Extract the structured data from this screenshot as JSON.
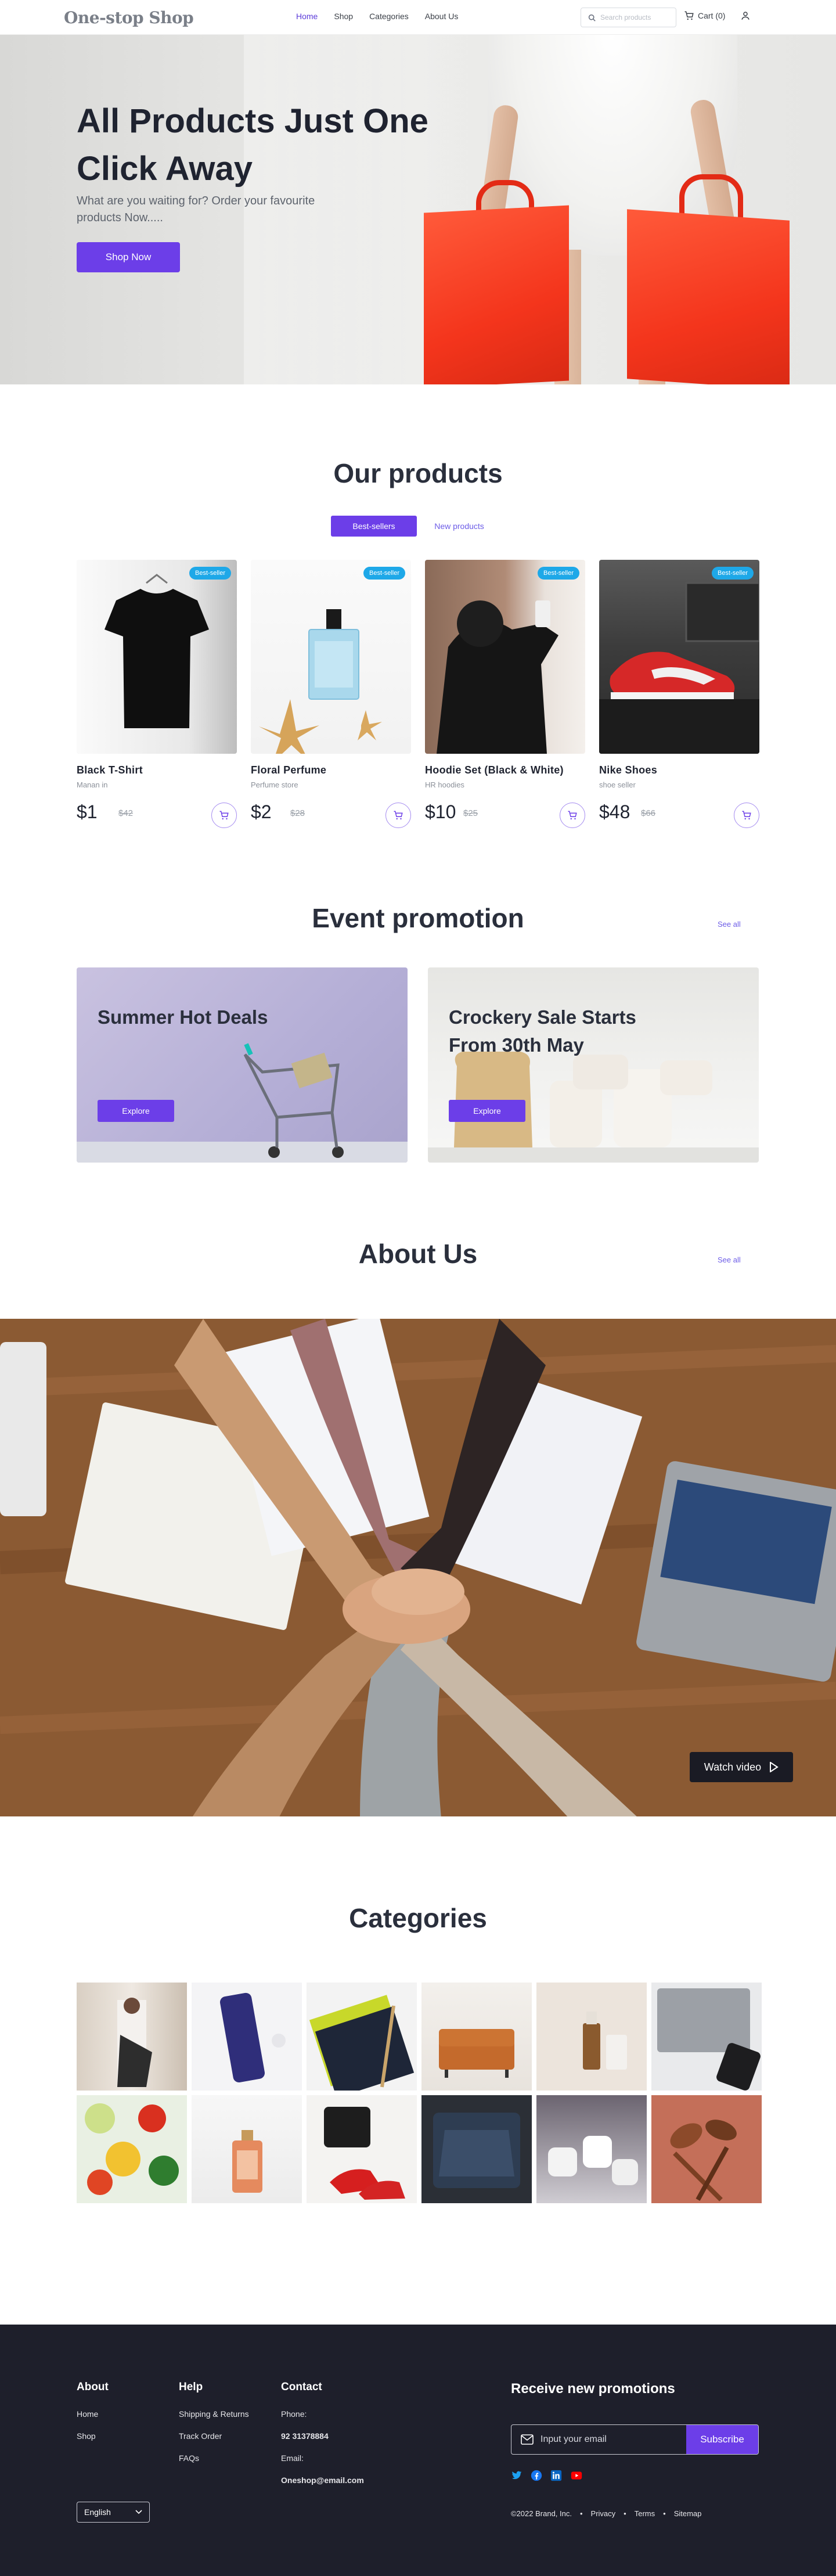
{
  "nav": {
    "logo": "One-stop Shop",
    "links": [
      "Home",
      "Shop",
      "Categories",
      "About Us"
    ],
    "search_placeholder": "Search products",
    "cart_label": "Cart (0)"
  },
  "hero": {
    "title": "All Products Just One Click Away",
    "subtitle": "What are you waiting for? Order your favourite products Now.....",
    "cta": "Shop Now"
  },
  "products": {
    "title": "Our products",
    "tabs": [
      "Best-sellers",
      "New products"
    ],
    "items": [
      {
        "name": "Black T-Shirt",
        "sub": "Manan in",
        "price": "$1",
        "old_price": "$42",
        "badge": "Best-seller"
      },
      {
        "name": "Floral Perfume",
        "sub": "Perfume store",
        "price": "$2",
        "old_price": "$28",
        "badge": "Best-seller"
      },
      {
        "name": "Hoodie Set (Black & White)",
        "sub": "HR hoodies",
        "price": "$10",
        "old_price": "$25",
        "badge": "Best-seller"
      },
      {
        "name": "Nike Shoes",
        "sub": "shoe seller",
        "price": "$48",
        "old_price": "$66",
        "badge": "Best-seller"
      }
    ]
  },
  "events": {
    "title": "Event promotion",
    "see_all": "See all",
    "items": [
      {
        "title": "Summer Hot Deals",
        "cta": "Explore"
      },
      {
        "title": "Crockery Sale Starts From 30th May",
        "cta": "Explore"
      }
    ]
  },
  "about": {
    "title": "About Us",
    "see_all": "See all",
    "watch_video": "Watch video"
  },
  "categories": {
    "title": "Categories"
  },
  "footer": {
    "about": {
      "heading": "About",
      "links": [
        "Home",
        "Shop"
      ]
    },
    "help": {
      "heading": "Help",
      "links": [
        "Shipping & Returns",
        "Track Order",
        "FAQs"
      ]
    },
    "contact": {
      "heading": "Contact",
      "phone_label": "Phone:",
      "phone": "92 31378884",
      "email_label": "Email:",
      "email": "Oneshop@email.com"
    },
    "language": "English",
    "promo_title": "Receive new promotions",
    "email_placeholder": "Input your email",
    "subscribe": "Subscribe",
    "copyright": "©2022 Brand, Inc.",
    "legal": [
      "Privacy",
      "Terms",
      "Sitemap"
    ]
  },
  "colors": {
    "accent": "#6c3ee8",
    "badge": "#1ea8e8",
    "footer_bg": "#1e1f2b"
  }
}
